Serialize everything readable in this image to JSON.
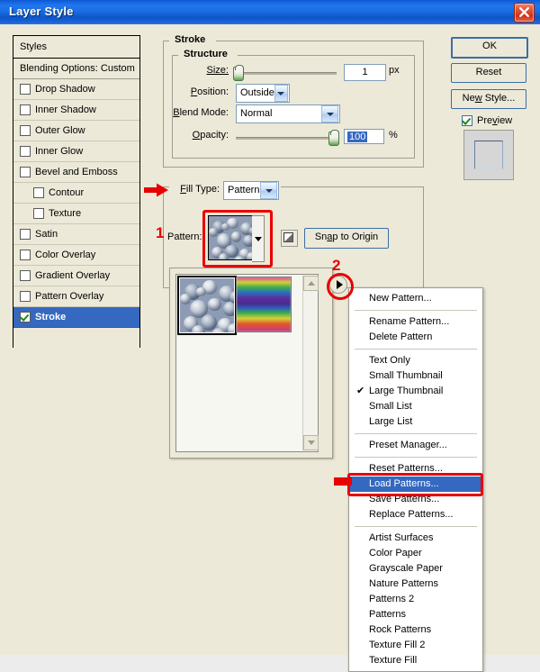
{
  "window": {
    "title": "Layer Style",
    "close_icon": "close-icon"
  },
  "styles_panel": {
    "header": "Styles",
    "blending_options": "Blending Options: Custom",
    "items": [
      {
        "label": "Drop Shadow",
        "checked": false,
        "indent": false,
        "selected": false
      },
      {
        "label": "Inner Shadow",
        "checked": false,
        "indent": false,
        "selected": false
      },
      {
        "label": "Outer Glow",
        "checked": false,
        "indent": false,
        "selected": false
      },
      {
        "label": "Inner Glow",
        "checked": false,
        "indent": false,
        "selected": false
      },
      {
        "label": "Bevel and Emboss",
        "checked": false,
        "indent": false,
        "selected": false
      },
      {
        "label": "Contour",
        "checked": false,
        "indent": true,
        "selected": false
      },
      {
        "label": "Texture",
        "checked": false,
        "indent": true,
        "selected": false
      },
      {
        "label": "Satin",
        "checked": false,
        "indent": false,
        "selected": false
      },
      {
        "label": "Color Overlay",
        "checked": false,
        "indent": false,
        "selected": false
      },
      {
        "label": "Gradient Overlay",
        "checked": false,
        "indent": false,
        "selected": false
      },
      {
        "label": "Pattern Overlay",
        "checked": false,
        "indent": false,
        "selected": false
      },
      {
        "label": "Stroke",
        "checked": true,
        "indent": false,
        "selected": true
      }
    ]
  },
  "stroke_group": {
    "title": "Stroke",
    "structure": {
      "title": "Structure",
      "size_label": "Size:",
      "size_value": "1",
      "size_unit": "px",
      "position_label": "Position:",
      "position_value": "Outside",
      "blend_mode_label": "Blend Mode:",
      "blend_mode_value": "Normal",
      "opacity_label": "Opacity:",
      "opacity_value": "100",
      "opacity_unit": "%"
    },
    "fill_type_label": "Fill Type:",
    "fill_type_value": "Pattern",
    "pattern_label": "Pattern:",
    "snap_to_origin": "Snap to Origin",
    "new_preset_icon": "new-preset-icon",
    "pattern_dropdown_icon": "chevron-down-icon"
  },
  "pattern_picker": {
    "menu_trigger_icon": "triangle-right-icon",
    "scroll_up_icon": "chevron-up-icon",
    "scroll_down_icon": "chevron-down-icon",
    "swatches": [
      {
        "name": "bubbles-pattern",
        "selected": true
      },
      {
        "name": "rainbow-pattern",
        "selected": false
      }
    ]
  },
  "context_menu": {
    "items": [
      {
        "label": "New Pattern...",
        "checked": false,
        "highlighted": false,
        "sep_after": true
      },
      {
        "label": "Rename Pattern...",
        "checked": false,
        "highlighted": false,
        "sep_after": false
      },
      {
        "label": "Delete Pattern",
        "checked": false,
        "highlighted": false,
        "sep_after": true
      },
      {
        "label": "Text Only",
        "checked": false,
        "highlighted": false,
        "sep_after": false
      },
      {
        "label": "Small Thumbnail",
        "checked": false,
        "highlighted": false,
        "sep_after": false
      },
      {
        "label": "Large Thumbnail",
        "checked": true,
        "highlighted": false,
        "sep_after": false
      },
      {
        "label": "Small List",
        "checked": false,
        "highlighted": false,
        "sep_after": false
      },
      {
        "label": "Large List",
        "checked": false,
        "highlighted": false,
        "sep_after": true
      },
      {
        "label": "Preset Manager...",
        "checked": false,
        "highlighted": false,
        "sep_after": true
      },
      {
        "label": "Reset Patterns...",
        "checked": false,
        "highlighted": false,
        "sep_after": false
      },
      {
        "label": "Load Patterns...",
        "checked": false,
        "highlighted": true,
        "sep_after": false
      },
      {
        "label": "Save Patterns...",
        "checked": false,
        "highlighted": false,
        "sep_after": false
      },
      {
        "label": "Replace Patterns...",
        "checked": false,
        "highlighted": false,
        "sep_after": true
      },
      {
        "label": "Artist Surfaces",
        "checked": false,
        "highlighted": false,
        "sep_after": false
      },
      {
        "label": "Color Paper",
        "checked": false,
        "highlighted": false,
        "sep_after": false
      },
      {
        "label": "Grayscale Paper",
        "checked": false,
        "highlighted": false,
        "sep_after": false
      },
      {
        "label": "Nature Patterns",
        "checked": false,
        "highlighted": false,
        "sep_after": false
      },
      {
        "label": "Patterns 2",
        "checked": false,
        "highlighted": false,
        "sep_after": false
      },
      {
        "label": "Patterns",
        "checked": false,
        "highlighted": false,
        "sep_after": false
      },
      {
        "label": "Rock Patterns",
        "checked": false,
        "highlighted": false,
        "sep_after": false
      },
      {
        "label": "Texture Fill 2",
        "checked": false,
        "highlighted": false,
        "sep_after": false
      },
      {
        "label": "Texture Fill",
        "checked": false,
        "highlighted": false,
        "sep_after": false
      }
    ],
    "check_glyph": "✔"
  },
  "buttons": {
    "ok": "OK",
    "reset": "Reset",
    "new_style": "New Style...",
    "preview_label": "Preview",
    "preview_checked": true
  },
  "annotations": {
    "callout_1": "1",
    "callout_2": "2",
    "accent_color": "#e80000",
    "arrow_icon": "red-arrow-right-icon"
  }
}
